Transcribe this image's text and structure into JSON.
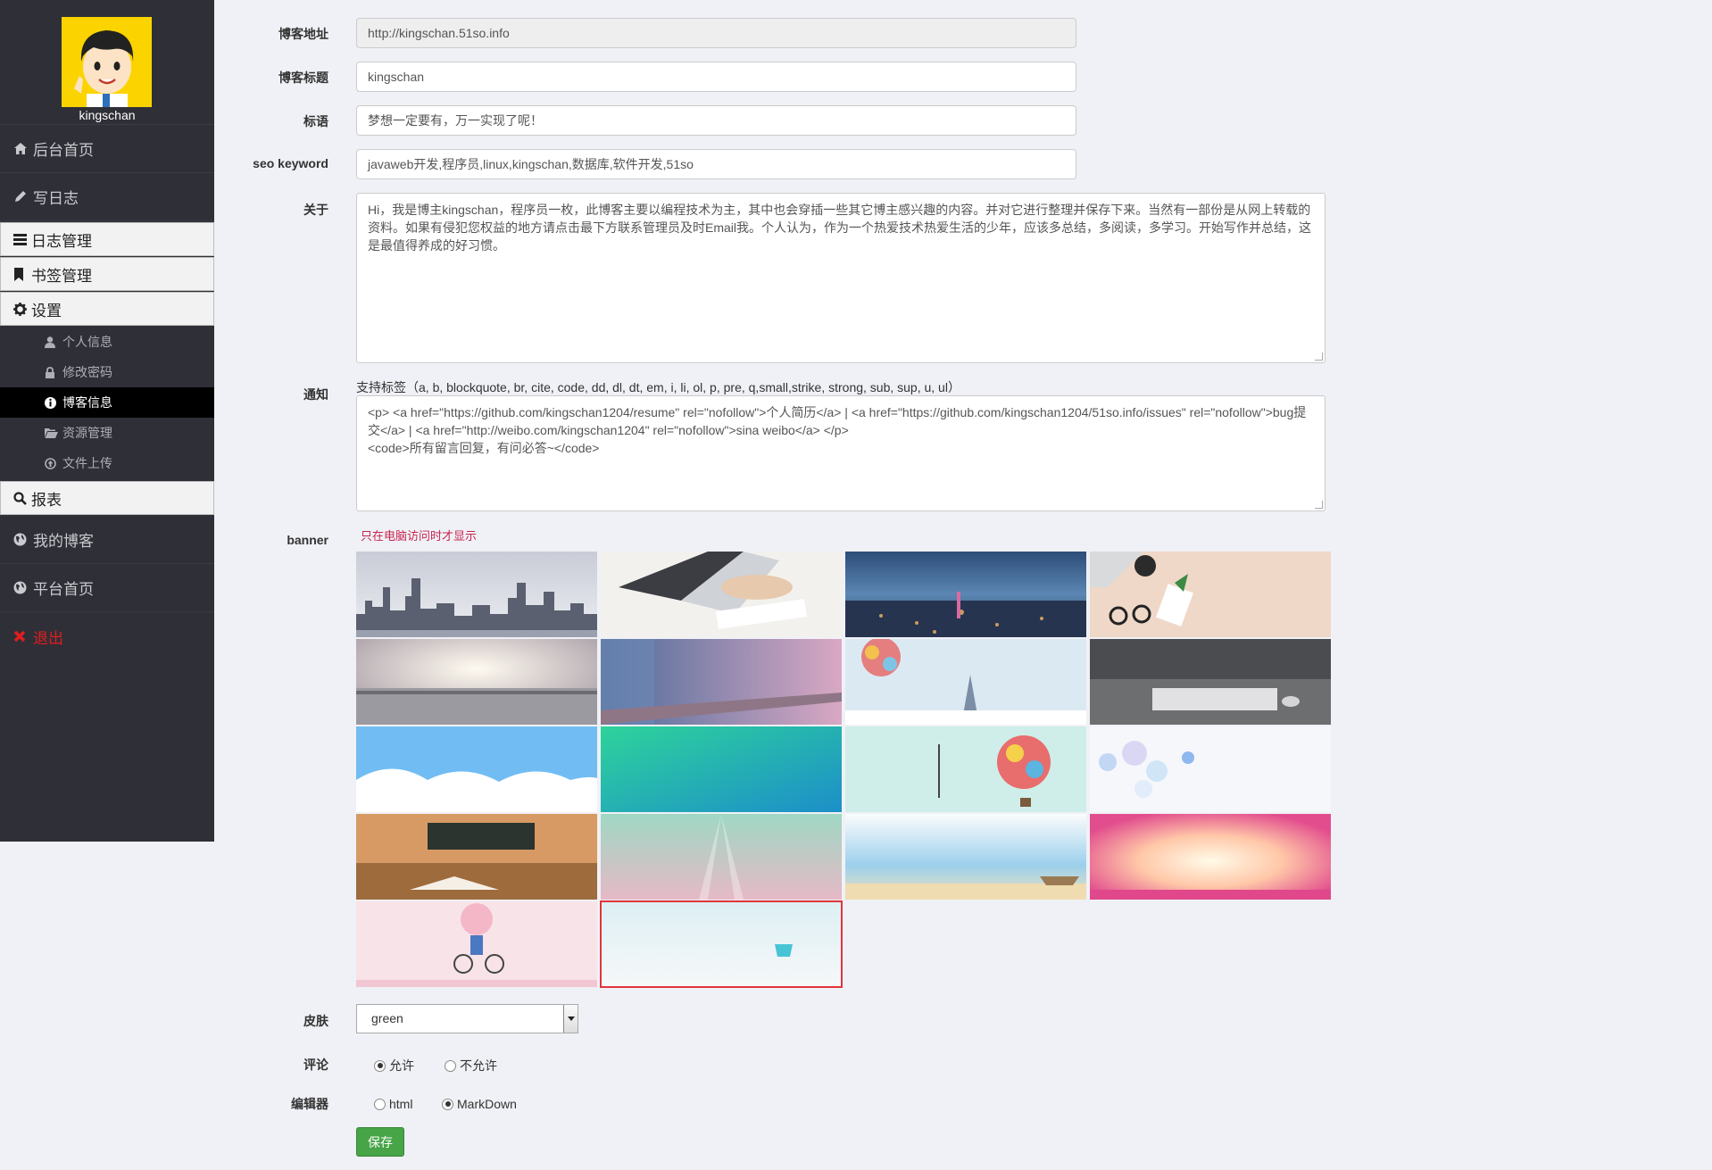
{
  "sidebar": {
    "username": "kingschan",
    "nav_top": [
      {
        "label": "后台首页",
        "icon": "home-icon"
      },
      {
        "label": "写日志",
        "icon": "pencil-icon"
      }
    ],
    "sections": {
      "log_manage": "日志管理",
      "bookmark_manage": "书签管理",
      "settings": "设置",
      "report": "报表"
    },
    "settings_items": [
      {
        "label": "个人信息",
        "icon": "user-icon"
      },
      {
        "label": "修改密码",
        "icon": "lock-icon"
      },
      {
        "label": "博客信息",
        "icon": "info-icon",
        "active": true
      },
      {
        "label": "资源管理",
        "icon": "folder-open-icon"
      },
      {
        "label": "文件上传",
        "icon": "upload-icon"
      }
    ],
    "nav_bottom": [
      {
        "label": "我的博客",
        "icon": "globe-icon"
      },
      {
        "label": "平台首页",
        "icon": "globe-icon"
      },
      {
        "label": "退出",
        "icon": "close-icon"
      }
    ]
  },
  "form": {
    "blog_url": {
      "label": "博客地址",
      "value": "http://kingschan.51so.info"
    },
    "blog_title": {
      "label": "博客标题",
      "value": "kingschan"
    },
    "slogan": {
      "label": "标语",
      "value": "梦想一定要有，万一实现了呢！"
    },
    "seo_keyword": {
      "label": "seo keyword",
      "value": "javaweb开发,程序员,linux,kingschan,数据库,软件开发,51so"
    },
    "about": {
      "label": "关于",
      "value": "Hi，我是博主kingschan，程序员一枚，此博客主要以编程技术为主，其中也会穿插一些其它博主感兴趣的内容。并对它进行整理并保存下来。当然有一部份是从网上转载的资料。如果有侵犯您权益的地方请点击最下方联系管理员及时Email我。个人认为，作为一个热爱技术热爱生活的少年，应该多总结，多阅读，多学习。开始写作并总结，这是最值得养成的好习惯。"
    },
    "notice": {
      "label": "通知",
      "hint": "支持标签（a, b, blockquote, br, cite, code, dd, dl, dt, em, i, li, ol, p, pre, q,small,strike, strong, sub, sup, u, ul）",
      "value": "<p> <a href=\"https://github.com/kingschan1204/resume\" rel=\"nofollow\">个人简历</a> | <a href=\"https://github.com/kingschan1204/51so.info/issues\" rel=\"nofollow\">bug提交</a> | <a href=\"http://weibo.com/kingschan1204\" rel=\"nofollow\">sina weibo</a> </p>\n<code>所有留言回复，有问必答~</code>"
    },
    "banner": {
      "label": "banner",
      "note": "只在电脑访问时才显示",
      "selected_index": 17,
      "tile_count": 18
    },
    "skin": {
      "label": "皮肤",
      "value": "green"
    },
    "comment": {
      "label": "评论",
      "options": [
        "允许",
        "不允许"
      ],
      "selected": "允许"
    },
    "editor": {
      "label": "编辑器",
      "options": [
        "html",
        "MarkDown"
      ],
      "selected": "MarkDown"
    },
    "save_label": "保存"
  },
  "colors": {
    "sidebar_bg": "#2f2f37",
    "page_bg": "#f0f1f6",
    "save_green": "#47a447",
    "note_red": "#c7254e",
    "logout_red": "#e21d1d"
  }
}
